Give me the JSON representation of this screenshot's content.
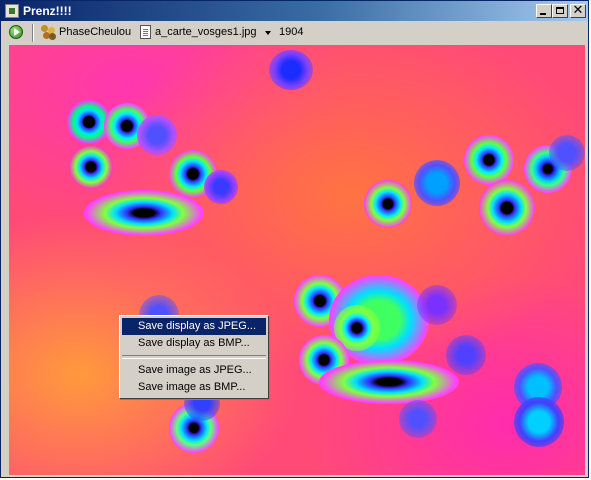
{
  "window": {
    "title": "Prenz!!!!"
  },
  "title_buttons": {
    "minimize": "minimize-button",
    "maximize": "maximize-button",
    "close": "close-button"
  },
  "toolbar": {
    "run_icon": "play-icon",
    "mode_icon": "phase-mode-icon",
    "mode_label": "PhaseCheulou",
    "file_icon": "file-icon",
    "file_label": "a_carte_vosges1.jpg",
    "frame_value": "1904"
  },
  "colors": {
    "title_active": "#0a246a",
    "menu_highlight": "#0a246a",
    "chrome": "#d4d0c8",
    "heatmap_base": "#ff4a78"
  },
  "context_menu": {
    "items": [
      {
        "label": "Save display as JPEG...",
        "highlighted": true
      },
      {
        "label": "Save display as BMP...",
        "highlighted": false
      },
      {
        "label": "Save image as JPEG...",
        "highlighted": false
      },
      {
        "label": "Save image as BMP...",
        "highlighted": false
      }
    ]
  }
}
